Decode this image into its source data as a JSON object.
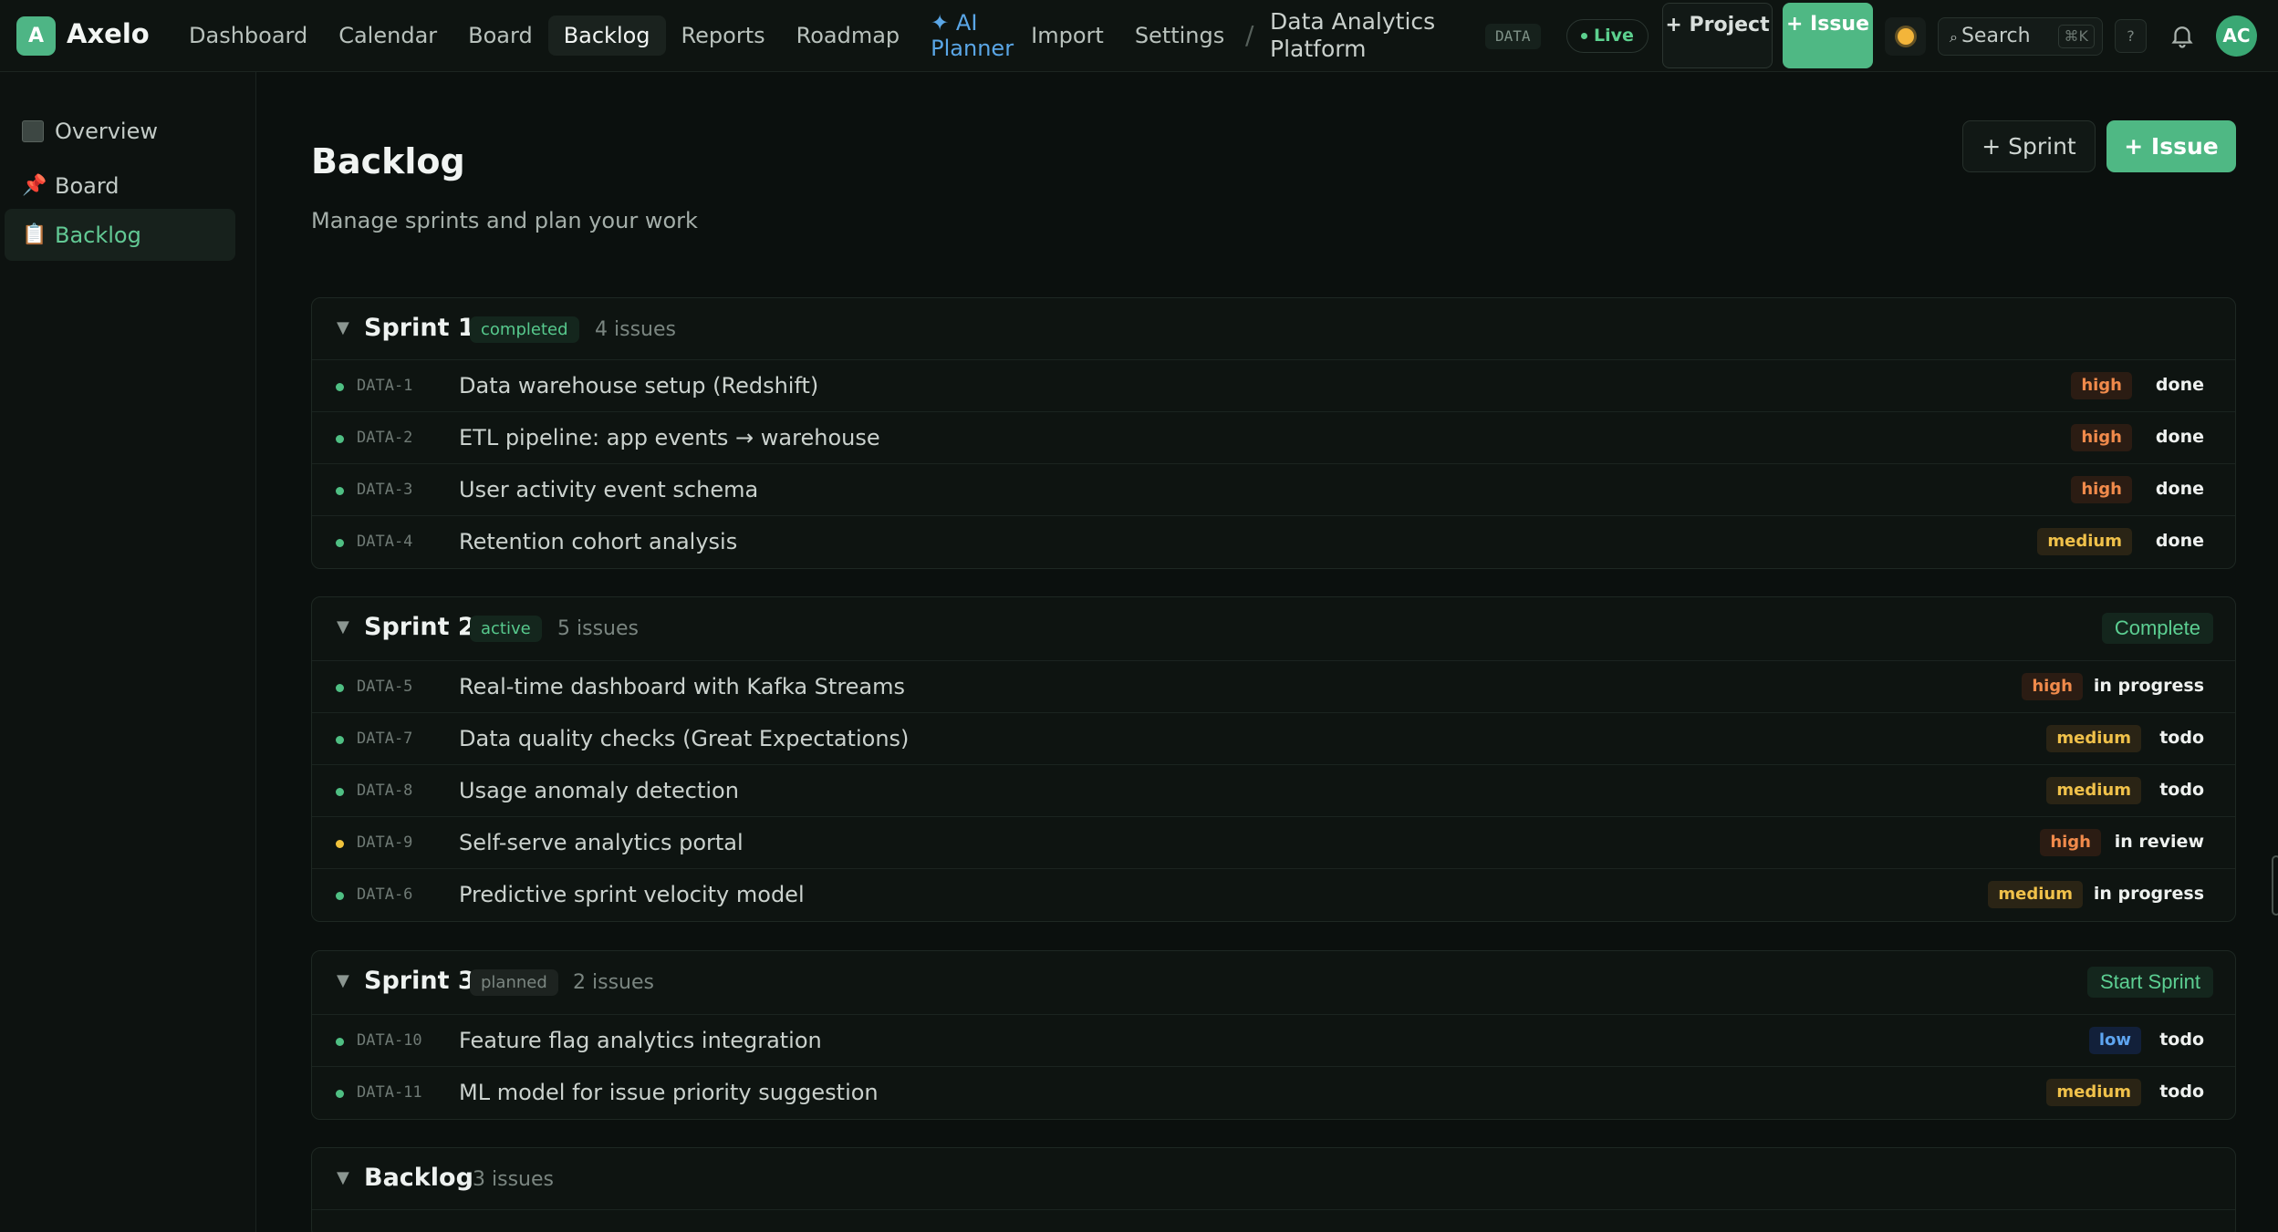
{
  "app": {
    "logo_letter": "A",
    "name": "Axelo"
  },
  "nav": {
    "items": [
      "Dashboard",
      "Calendar",
      "Board",
      "Backlog",
      "Reports",
      "Roadmap",
      "✦ AI Planner",
      "Import",
      "Settings"
    ],
    "active": "Backlog"
  },
  "breadcrumb": {
    "separator": "/",
    "project": "Data Analytics Platform"
  },
  "header": {
    "project_key": "DATA",
    "live_label": "Live",
    "new_project_label": "+ Project",
    "new_issue_label": "+ Issue",
    "search_label": "Search",
    "search_shortcut": "⌘K",
    "help_label": "?",
    "avatar_initials": "AC"
  },
  "sidebar": {
    "items": [
      {
        "label": "Overview",
        "icon": "overview-square-icon"
      },
      {
        "label": "Board",
        "icon": "pushpin-icon"
      },
      {
        "label": "Backlog",
        "icon": "clipboard-icon"
      }
    ],
    "active": "Backlog"
  },
  "page": {
    "title": "Backlog",
    "subtitle": "Manage sprints and plan your work",
    "add_sprint_label": "+ Sprint",
    "add_issue_label": "+ Issue"
  },
  "colors": {
    "accent": "#4fb884",
    "priority_high": "#f08a4b",
    "priority_medium": "#f0c14a",
    "priority_low": "#5ea5f0"
  },
  "sprints": [
    {
      "name": "Sprint 1",
      "status": "completed",
      "count": "4 issues",
      "action": "",
      "issues": [
        {
          "key": "DATA-1",
          "title": "Data warehouse setup (Redshift)",
          "priority": "high",
          "status": "done"
        },
        {
          "key": "DATA-2",
          "title": "ETL pipeline: app events → warehouse",
          "priority": "high",
          "status": "done"
        },
        {
          "key": "DATA-3",
          "title": "User activity event schema",
          "priority": "high",
          "status": "done"
        },
        {
          "key": "DATA-4",
          "title": "Retention cohort analysis",
          "priority": "medium",
          "status": "done"
        }
      ]
    },
    {
      "name": "Sprint 2",
      "status": "active",
      "count": "5 issues",
      "action": "Complete",
      "issues": [
        {
          "key": "DATA-5",
          "title": "Real-time dashboard with Kafka Streams",
          "priority": "high",
          "status": "in progress"
        },
        {
          "key": "DATA-7",
          "title": "Data quality checks (Great Expectations)",
          "priority": "medium",
          "status": "todo"
        },
        {
          "key": "DATA-8",
          "title": "Usage anomaly detection",
          "priority": "medium",
          "status": "todo"
        },
        {
          "key": "DATA-9",
          "title": "Self-serve analytics portal",
          "priority": "high",
          "status": "in review"
        },
        {
          "key": "DATA-6",
          "title": "Predictive sprint velocity model",
          "priority": "medium",
          "status": "in progress"
        }
      ]
    },
    {
      "name": "Sprint 3",
      "status": "planned",
      "count": "2 issues",
      "action": "Start Sprint",
      "issues": [
        {
          "key": "DATA-10",
          "title": "Feature flag analytics integration",
          "priority": "low",
          "status": "todo"
        },
        {
          "key": "DATA-11",
          "title": "ML model for issue priority suggestion",
          "priority": "medium",
          "status": "todo"
        }
      ]
    },
    {
      "name": "Backlog",
      "status": "",
      "count": "3 issues",
      "action": "",
      "issues": []
    }
  ]
}
